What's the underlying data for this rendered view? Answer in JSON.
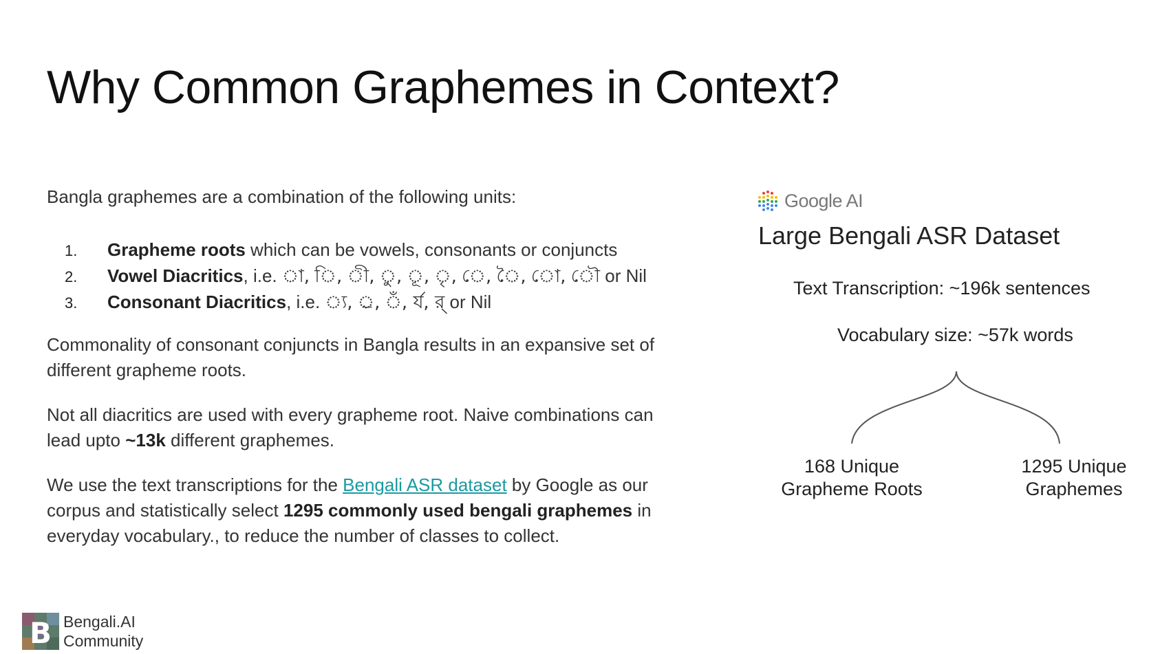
{
  "title": "Why Common Graphemes in Context?",
  "intro": "Bangla graphemes are a combination of the following units:",
  "units": [
    {
      "num": "1.",
      "bold": "Grapheme roots",
      "rest": " which can be vowels, consonants or conjuncts",
      "glyphs": "",
      "tail": ""
    },
    {
      "num": "2.",
      "bold": "Vowel Diacritics",
      "rest": ", i.e. ",
      "glyphs": " া, ি, ী, ু, ূ, ৃ, ে, ৈ, ো, ৌ",
      "tail": " or Nil"
    },
    {
      "num": "3.",
      "bold": "Consonant Diacritics",
      "rest": ", i.e. ",
      "glyphs": " ্য, ্র, ঁ, র্য, র্",
      "tail": " or Nil"
    }
  ],
  "para1": "Commonality of consonant conjuncts in Bangla results in an expansive set of different grapheme roots.",
  "para2": {
    "before": "Not all diacritics are used with every grapheme root. Naive combinations can lead upto ",
    "bold": "~13k",
    "after": " different graphemes."
  },
  "para3": {
    "before": "We use the text transcriptions for the ",
    "link": "Bengali ASR dataset",
    "middle": " by Google as our corpus and statistically select ",
    "bold": "1295 commonly used bengali graphemes",
    "after": " in everyday vocabulary., to reduce the number of classes to collect."
  },
  "right": {
    "logo_text": "Google AI",
    "title": "Large Bengali ASR Dataset",
    "stat1": "Text Transcription: ~196k sentences",
    "stat2": "Vocabulary size: ~57k words",
    "leaf1_line1": "168 Unique",
    "leaf1_line2": "Grapheme Roots",
    "leaf2_line1": "1295 Unique",
    "leaf2_line2": "Graphemes"
  },
  "footer": {
    "line1": "Bengali.AI",
    "line2": "Community"
  },
  "colors": {
    "link": "#1a9aa0",
    "text": "#333333",
    "title": "#111111"
  }
}
